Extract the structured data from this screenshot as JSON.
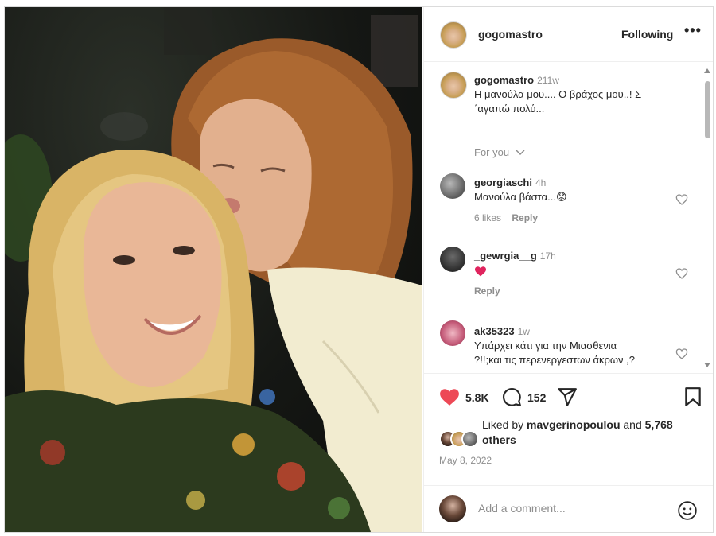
{
  "post": {
    "username": "gogomastro",
    "follow_status": "Following",
    "more_label": "•••"
  },
  "caption": {
    "username": "gogomastro",
    "time": "211w",
    "text_line1": "Η μανούλα μου.... Ο βράχος μου..! Σ",
    "text_line2": "΄αγαπώ πολύ..."
  },
  "filter": {
    "label": "For you",
    "icon": "chevron-down-icon"
  },
  "comments": [
    {
      "username": "georgiaschi",
      "time": "4h",
      "text": "Μανούλα βάστα...",
      "emoji": "😟",
      "likes": "6 likes",
      "reply": "Reply"
    },
    {
      "username": "_gewrgia__g",
      "time": "17h",
      "text": "",
      "emoji": "❤️",
      "reply": "Reply"
    },
    {
      "username": "ak35323",
      "time": "1w",
      "text_line1": "Υπάρχει κάτι για την Μιασθενια",
      "text_line2": "?!!;και τις περενεργεστων άκρων ,?"
    }
  ],
  "stats": {
    "likes": "5.8K",
    "comments": "152"
  },
  "liked_by": {
    "prefix": "Liked by ",
    "user": "mavgerinopoulou",
    "middle": " and ",
    "count": "5,768",
    "suffix": "others"
  },
  "date": "May 8, 2022",
  "add_comment": {
    "placeholder": "Add a comment..."
  },
  "colors": {
    "like_red": "#ed4956",
    "text_primary": "#262626",
    "text_secondary": "#8e8e8e"
  }
}
